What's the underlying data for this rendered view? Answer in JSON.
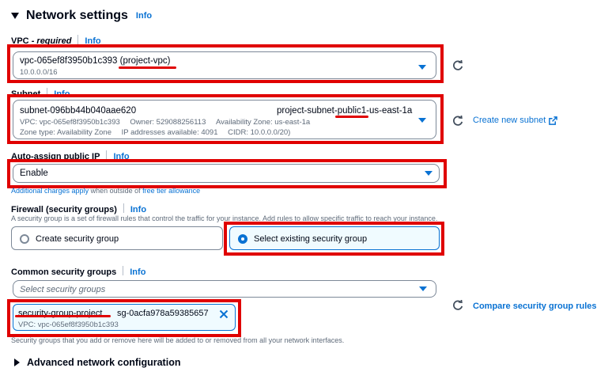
{
  "section": {
    "title": "Network settings",
    "info": "Info"
  },
  "vpc": {
    "label": "VPC",
    "required": "- required",
    "info": "Info",
    "value_id": "vpc-065ef8f3950b1c393",
    "value_name": "(project-vpc)",
    "cidr": "10.0.0.0/16"
  },
  "subnet": {
    "label": "Subnet",
    "info": "Info",
    "id": "subnet-096bb44b040aae620",
    "name": "project-subnet-public1-us-east-1a",
    "line1_vpc": "VPC: vpc-065ef8f3950b1c393",
    "line1_owner": "Owner: 529088256113",
    "line1_az": "Availability Zone: us-east-1a",
    "line2_zone": "Zone type: Availability Zone",
    "line2_ips": "IP addresses available: 4091",
    "line2_cidr": "CIDR: 10.0.0.0/20)",
    "create_link": "Create new subnet"
  },
  "auto_ip": {
    "label": "Auto-assign public IP",
    "info": "Info",
    "value": "Enable",
    "note_link1": "Additional charges apply",
    "note_mid": " when outside of ",
    "note_link2": "free tier allowance"
  },
  "firewall": {
    "label": "Firewall (security groups)",
    "info": "Info",
    "description": "A security group is a set of firewall rules that control the traffic for your instance. Add rules to allow specific traffic to reach your instance.",
    "option_create": "Create security group",
    "option_select": "Select existing security group",
    "selected": "Select existing security group"
  },
  "common_sg": {
    "label": "Common security groups",
    "info": "Info",
    "placeholder": "Select security groups",
    "compare_link": "Compare security group rules",
    "token_name": "security-group-project",
    "token_id": "sg-0acfa978a59385657",
    "token_vpc": "VPC: vpc-065ef8f3950b1c393",
    "note": "Security groups that you add or remove here will be added to or removed from all your network interfaces."
  },
  "advanced": {
    "title": "Advanced network configuration"
  },
  "colors": {
    "accent": "#0972d3",
    "annotation": "#e00000",
    "text": "#000716",
    "muted": "#5f6b7a"
  }
}
